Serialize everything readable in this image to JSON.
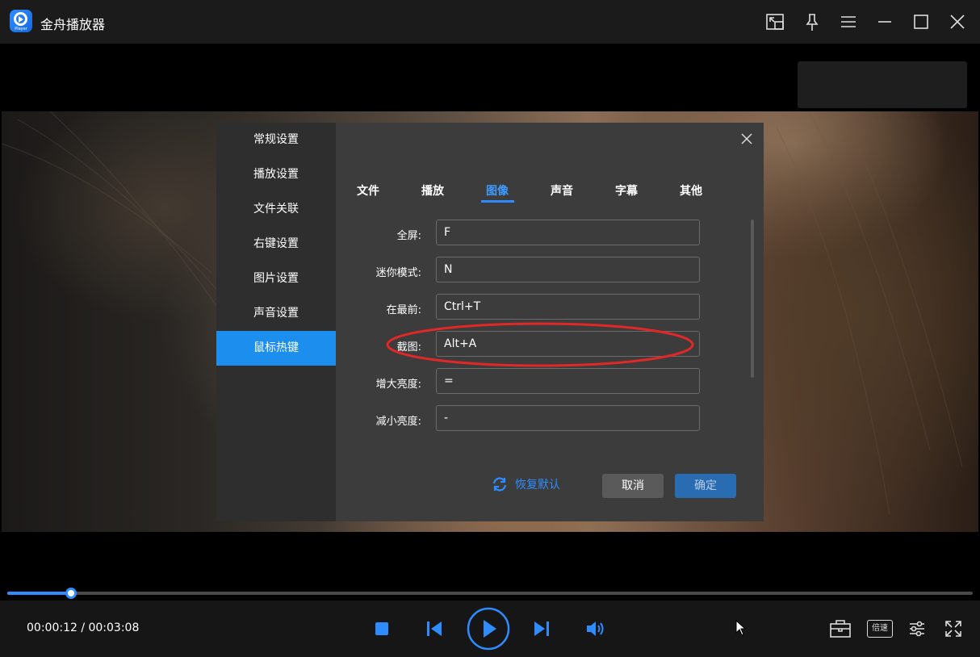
{
  "app": {
    "title": "金舟播放器",
    "logo_text": "Player"
  },
  "window_controls": [
    "picture-in-picture-icon",
    "pin-icon",
    "menu-icon",
    "minimize-icon",
    "maximize-icon",
    "close-icon"
  ],
  "dialog": {
    "sidebar": [
      {
        "label": "常规设置",
        "active": false
      },
      {
        "label": "播放设置",
        "active": false
      },
      {
        "label": "文件关联",
        "active": false
      },
      {
        "label": "右键设置",
        "active": false
      },
      {
        "label": "图片设置",
        "active": false
      },
      {
        "label": "声音设置",
        "active": false
      },
      {
        "label": "鼠标热键",
        "active": true
      }
    ],
    "tabs": [
      {
        "label": "文件",
        "active": false
      },
      {
        "label": "播放",
        "active": false
      },
      {
        "label": "图像",
        "active": true
      },
      {
        "label": "声音",
        "active": false
      },
      {
        "label": "字幕",
        "active": false
      },
      {
        "label": "其他",
        "active": false
      }
    ],
    "hotkeys": [
      {
        "label": "全屏:",
        "value": "F"
      },
      {
        "label": "迷你模式:",
        "value": "N"
      },
      {
        "label": "在最前:",
        "value": "Ctrl+T"
      },
      {
        "label": "截图:",
        "value": "Alt+A"
      },
      {
        "label": "增大亮度:",
        "value": "="
      },
      {
        "label": "减小亮度:",
        "value": "-"
      }
    ],
    "restore_label": "恢复默认",
    "cancel_label": "取消",
    "ok_label": "确定"
  },
  "player": {
    "current_time": "00:00:12",
    "total_time": "00:03:08",
    "time_display": "00:00:12 / 00:03:08",
    "progress": 0.066,
    "speed_label": "倍速"
  },
  "colors": {
    "accent": "#2e8cff",
    "annotation": "#e02828"
  }
}
